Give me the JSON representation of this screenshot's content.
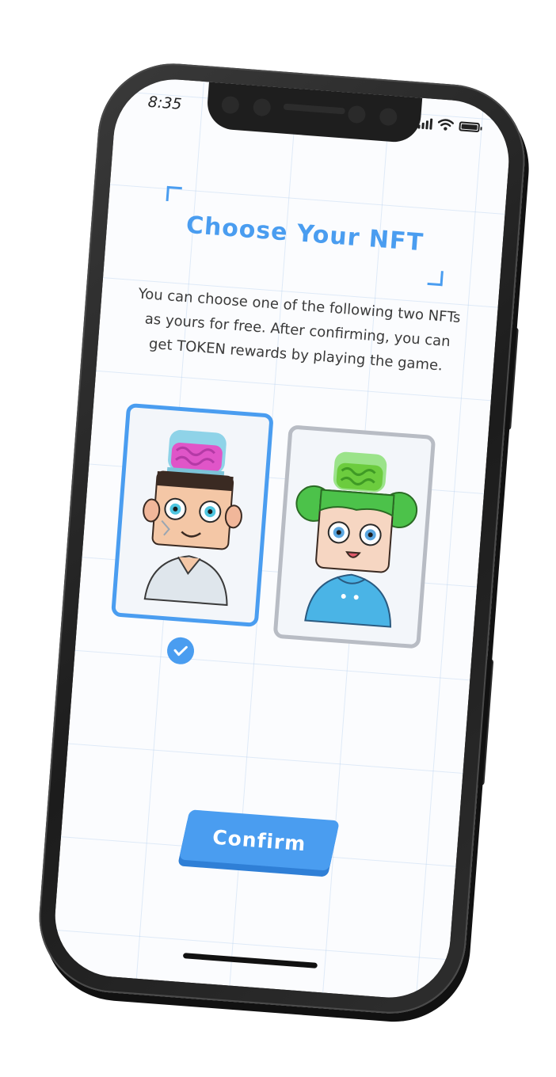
{
  "status_bar": {
    "time": "8:35",
    "icons": [
      "signal-icon",
      "wifi-icon",
      "battery-icon"
    ]
  },
  "page": {
    "title": "Choose Your NFT",
    "description": "You can choose one of the following two NFTs as yours for free. After confirming, you can get TOKEN rewards by playing the game."
  },
  "nft_options": [
    {
      "avatar": "boy-avatar-pink-brain",
      "selected": true
    },
    {
      "avatar": "girl-avatar-green-brain",
      "selected": false
    }
  ],
  "confirm_button": {
    "label": "Confirm"
  },
  "colors": {
    "accent": "#4a9df0",
    "unselected_border": "#b8bcc4",
    "text": "#3a3a3a",
    "device": "#1e1e1e"
  }
}
